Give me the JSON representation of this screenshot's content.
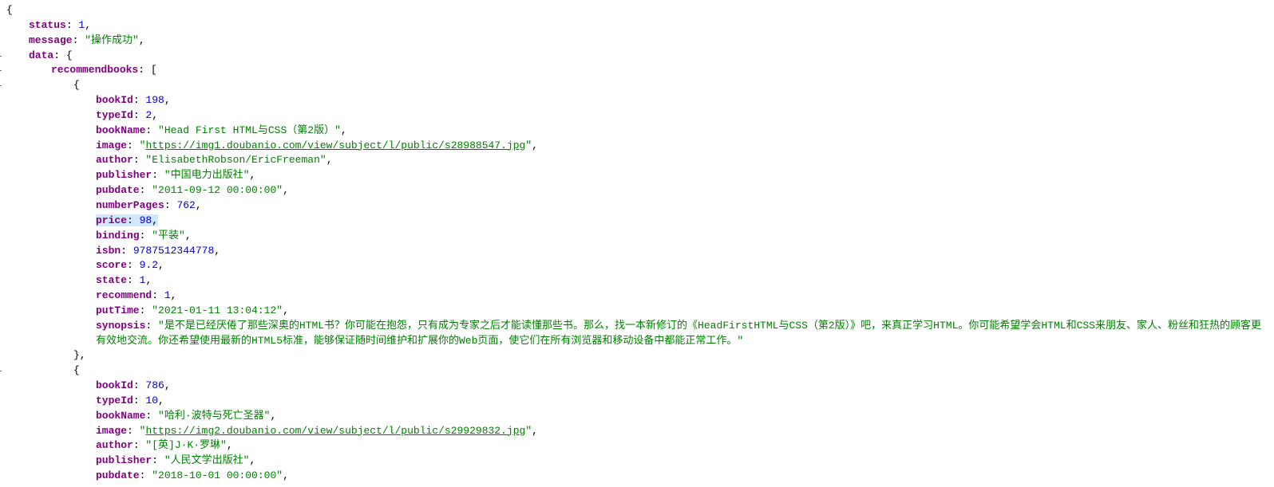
{
  "toggle": "-",
  "root": {
    "status_key": "status",
    "status_val": "1",
    "message_key": "message",
    "message_val": "操作成功",
    "data_key": "data",
    "recommend_key": "recommendbooks"
  },
  "book1": {
    "bookId_key": "bookId",
    "bookId_val": "198",
    "typeId_key": "typeId",
    "typeId_val": "2",
    "bookName_key": "bookName",
    "bookName_val": "Head First HTML与CSS（第2版）",
    "image_key": "image",
    "image_val": "https://img1.doubanio.com/view/subject/l/public/s28988547.jpg",
    "author_key": "author",
    "author_val": "ElisabethRobson/EricFreeman",
    "publisher_key": "publisher",
    "publisher_val": "中国电力出版社",
    "pubdate_key": "pubdate",
    "pubdate_val": "2011-09-12 00:00:00",
    "numberPages_key": "numberPages",
    "numberPages_val": "762",
    "price_key": "price",
    "price_val": "98",
    "binding_key": "binding",
    "binding_val": "平装",
    "isbn_key": "isbn",
    "isbn_val": "9787512344778",
    "score_key": "score",
    "score_val": "9.2",
    "state_key": "state",
    "state_val": "1",
    "recommend_key": "recommend",
    "recommend_val": "1",
    "putTime_key": "putTime",
    "putTime_val": "2021-01-11 13:04:12",
    "synopsis_key": "synopsis",
    "synopsis_val": "是不是已经厌倦了那些深奥的HTML书？你可能在抱怨，只有成为专家之后才能读懂那些书。那么，找一本新修订的《HeadFirstHTML与CSS（第2版）》吧，来真正学习HTML。你可能希望学会HTML和CSS来朋友、家人、粉丝和狂热的顾客更有效地交流。你还希望使用最新的HTML5标准，能够保证随时间维护和扩展你的Web页面，使它们在所有浏览器和移动设备中都能正常工作。"
  },
  "book2": {
    "bookId_key": "bookId",
    "bookId_val": "786",
    "typeId_key": "typeId",
    "typeId_val": "10",
    "bookName_key": "bookName",
    "bookName_val": "哈利·波特与死亡圣器",
    "image_key": "image",
    "image_val": "https://img2.doubanio.com/view/subject/l/public/s29929832.jpg",
    "author_key": "author",
    "author_val": "[英]J·K·罗琳",
    "publisher_key": "publisher",
    "publisher_val": "人民文学出版社",
    "pubdate_key": "pubdate",
    "pubdate_val": "2018-10-01 00:00:00"
  }
}
